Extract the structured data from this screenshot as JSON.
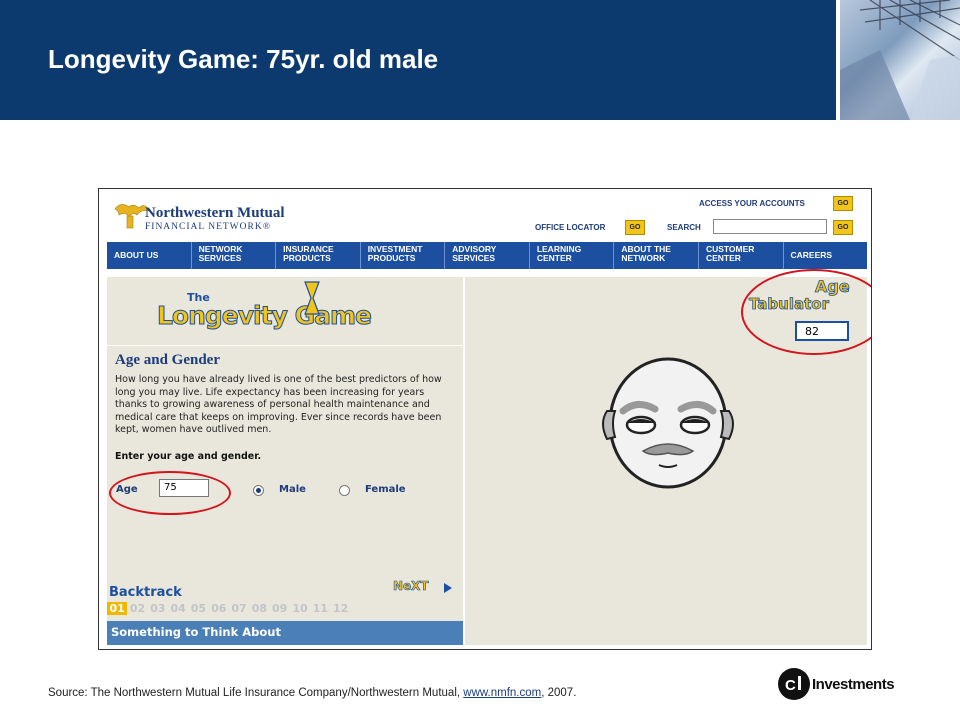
{
  "slide": {
    "title": "Longevity Game: 75yr. old male",
    "source_prefix": "Source: The Northwestern Mutual Life Insurance Company/Northwestern Mutual, ",
    "source_link": "www.nmfn.com",
    "source_suffix": ", 2007.",
    "brand": "Investments"
  },
  "nm_header": {
    "name_line1": "Northwestern Mutual",
    "name_line2": "FINANCIAL NETWORK®",
    "access_accounts": "ACCESS YOUR ACCOUNTS",
    "office_locator": "OFFICE LOCATOR",
    "search_label": "SEARCH",
    "go": "GO"
  },
  "nav": [
    {
      "line1": "ABOUT US",
      "line2": ""
    },
    {
      "line1": "NETWORK",
      "line2": "SERVICES"
    },
    {
      "line1": "INSURANCE",
      "line2": "PRODUCTS"
    },
    {
      "line1": "INVESTMENT",
      "line2": "PRODUCTS"
    },
    {
      "line1": "ADVISORY",
      "line2": "SERVICES"
    },
    {
      "line1": "LEARNING",
      "line2": "CENTER"
    },
    {
      "line1": "ABOUT THE",
      "line2": "NETWORK"
    },
    {
      "line1": "CUSTOMER",
      "line2": "CENTER"
    },
    {
      "line1": "CAREERS",
      "line2": ""
    }
  ],
  "game": {
    "logo_the": "The",
    "logo_main": "Longevity Game",
    "section_heading": "Age and Gender",
    "body": "How long you have already lived is one of the best predictors of how long you may live. Life expectancy has been increasing for years thanks to growing awareness of personal health maintenance and medical care that keeps on improving. Ever since records have been kept, women have outlived men.",
    "prompt": "Enter your age and gender.",
    "age_label": "Age",
    "age_value": "75",
    "male_label": "Male",
    "female_label": "Female",
    "selected_gender": "Male",
    "backtrack": "Backtrack",
    "next": "NeXT",
    "steps": [
      "01",
      "02",
      "03",
      "04",
      "05",
      "06",
      "07",
      "08",
      "09",
      "10",
      "11",
      "12"
    ],
    "current_step": "01",
    "think_about": "Something to Think About"
  },
  "tabulator": {
    "title_line1": "Age",
    "title_line2": "Tabulator",
    "value": "82"
  },
  "colors": {
    "header_navy": "#0d3a6e",
    "nm_blue": "#1d4fa0",
    "gold": "#f0c419",
    "highlight_red": "#d4141c",
    "panel_bg": "#e9e7dc"
  }
}
